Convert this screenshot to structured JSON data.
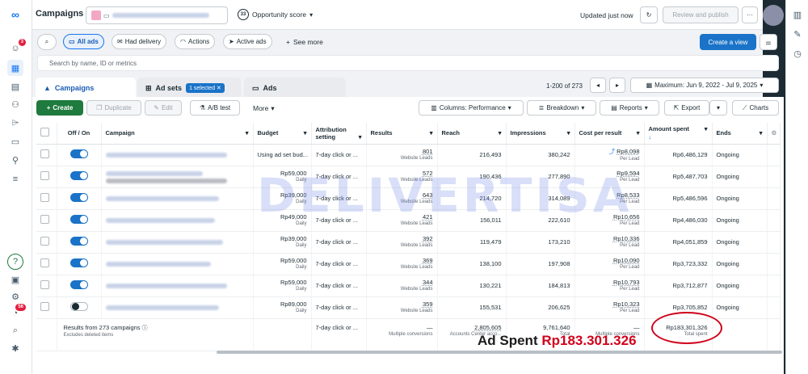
{
  "header": {
    "title": "Campaigns",
    "account_name": "",
    "opportunity_score": "33",
    "opportunity_label": "Opportunity score",
    "updated_text": "Updated just now",
    "review_label": "Review and publish"
  },
  "filters": {
    "all_ads": "All ads",
    "had_delivery": "Had delivery",
    "actions": "Actions",
    "active_ads": "Active ads",
    "see_more": "See more",
    "create_view": "Create a view"
  },
  "search": {
    "placeholder": "Search by name, ID or metrics"
  },
  "tabs": {
    "campaigns": "Campaigns",
    "adsets": "Ad sets",
    "adsets_selected": "1 selected",
    "ads": "Ads",
    "paging": "1-200 of 273",
    "date_range": "Maximum: Jun 9, 2022 - Jul 9, 2025"
  },
  "toolbar": {
    "create": "Create",
    "duplicate": "Duplicate",
    "edit": "Edit",
    "ab_test": "A/B test",
    "more": "More",
    "columns": "Columns: Performance",
    "breakdown": "Breakdown",
    "reports": "Reports",
    "export": "Export",
    "charts": "Charts"
  },
  "columns": {
    "off_on": "Off / On",
    "campaign": "Campaign",
    "budget": "Budget",
    "attribution": "Attribution setting",
    "results": "Results",
    "reach": "Reach",
    "impressions": "Impressions",
    "cost_per_result": "Cost per result",
    "amount_spent": "Amount spent",
    "ends": "Ends"
  },
  "rows": [
    {
      "on": true,
      "budget": "Using ad set bud...",
      "budget_sub": "",
      "attribution": "7-day click or ...",
      "results": "801",
      "reach": "216,493",
      "impressions": "380,242",
      "cpr": "Rp8,098",
      "spent": "Rp6,486,129",
      "ends": "Ongoing"
    },
    {
      "on": true,
      "budget": "Rp59,000",
      "budget_sub": "Daily",
      "attribution": "7-day click or ...",
      "results": "572",
      "reach": "190,436",
      "impressions": "277,890",
      "cpr": "Rp9,594",
      "spent": "Rp5,487,703",
      "ends": "Ongoing"
    },
    {
      "on": true,
      "budget": "Rp39,000",
      "budget_sub": "Daily",
      "attribution": "7-day click or ...",
      "results": "643",
      "reach": "214,720",
      "impressions": "314,089",
      "cpr": "Rp8,533",
      "spent": "Rp5,486,596",
      "ends": "Ongoing"
    },
    {
      "on": true,
      "budget": "Rp49,000",
      "budget_sub": "Daily",
      "attribution": "7-day click or ...",
      "results": "421",
      "reach": "156,011",
      "impressions": "222,610",
      "cpr": "Rp10,656",
      "spent": "Rp4,486,030",
      "ends": "Ongoing"
    },
    {
      "on": true,
      "budget": "Rp39,000",
      "budget_sub": "Daily",
      "attribution": "7-day click or ...",
      "results": "392",
      "reach": "119,479",
      "impressions": "173,210",
      "cpr": "Rp10,336",
      "spent": "Rp4,051,859",
      "ends": "Ongoing"
    },
    {
      "on": true,
      "budget": "Rp59,000",
      "budget_sub": "Daily",
      "attribution": "7-day click or ...",
      "results": "369",
      "reach": "138,100",
      "impressions": "197,908",
      "cpr": "Rp10,090",
      "spent": "Rp3,723,332",
      "ends": "Ongoing"
    },
    {
      "on": true,
      "budget": "Rp59,000",
      "budget_sub": "Daily",
      "attribution": "7-day click or ...",
      "results": "344",
      "reach": "130,221",
      "impressions": "184,813",
      "cpr": "Rp10,793",
      "spent": "Rp3,712,877",
      "ends": "Ongoing"
    },
    {
      "on": false,
      "budget": "Rp89,000",
      "budget_sub": "Daily",
      "attribution": "7-day click or ...",
      "results": "359",
      "reach": "155,531",
      "impressions": "206,625",
      "cpr": "Rp10,323",
      "spent": "Rp3,705,852",
      "ends": "Ongoing"
    }
  ],
  "results_sub": "Website Leads",
  "cpr_sub": "Per Lead",
  "summary": {
    "label": "Results from 273 campaigns",
    "sub": "Excludes deleted items",
    "attribution": "7-day click or ...",
    "results": "—",
    "results_sub": "Multiple conversions",
    "reach": "2,805,605",
    "reach_sub": "Accounts Center acco...",
    "impressions": "9,761,640",
    "impressions_sub": "Total",
    "cpr": "—",
    "cpr_sub": "Multiple conversions",
    "spent": "Rp183,301,326",
    "spent_sub": "Total spent"
  },
  "annotation": {
    "prefix": "Ad Spent",
    "value": "Rp183.301.326"
  },
  "watermark": "DELIVERTISA",
  "badges": {
    "notifications": "3",
    "alerts": "56"
  },
  "colors": {
    "primary": "#1a73c8",
    "create": "#1f7a3e",
    "annotation": "#d0021b"
  }
}
